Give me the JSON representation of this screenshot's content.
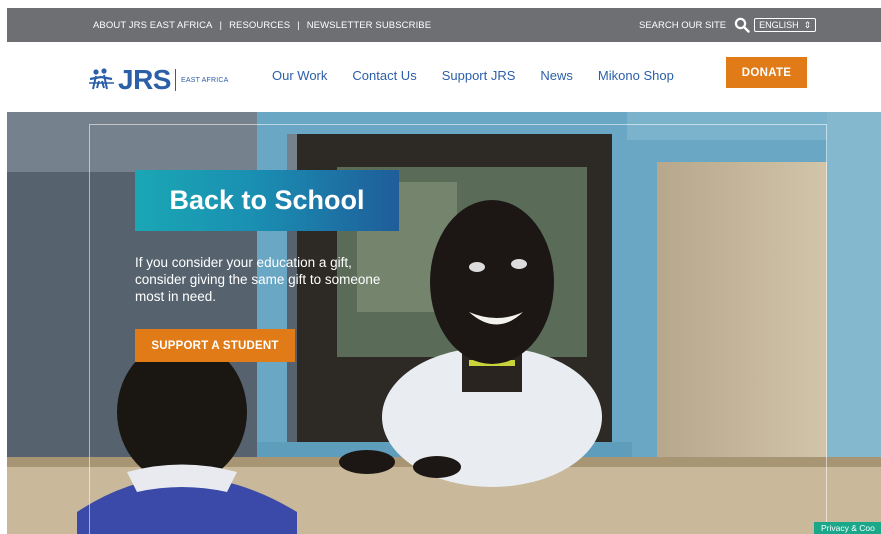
{
  "topbar": {
    "links": [
      "ABOUT JRS EAST AFRICA",
      "RESOURCES",
      "NEWSLETTER SUBSCRIBE"
    ],
    "separator": "|",
    "search_label": "SEARCH OUR SITE",
    "language": "ENGLISH",
    "language_arrow": "⇕"
  },
  "header": {
    "logo": {
      "text": "JRS",
      "region": "EAST AFRICA"
    },
    "nav": [
      "Our Work",
      "Contact Us",
      "Support JRS",
      "News",
      "Mikono Shop"
    ],
    "donate_label": "DONATE"
  },
  "hero": {
    "headline": "Back to School",
    "tagline": "If you consider your education a gift, consider giving the same gift to someone most in need.",
    "cta_label": "SUPPORT A STUDENT"
  },
  "privacy_badge": "Privacy & Coo",
  "colors": {
    "topbar_bg": "#6d6f72",
    "brand_blue": "#2b5fa8",
    "accent_orange": "#e07b18",
    "headline_teal": "#1aa7b4"
  },
  "icons": {
    "search": "magnifier-icon",
    "logo_mark": "jrs-people-icon"
  }
}
